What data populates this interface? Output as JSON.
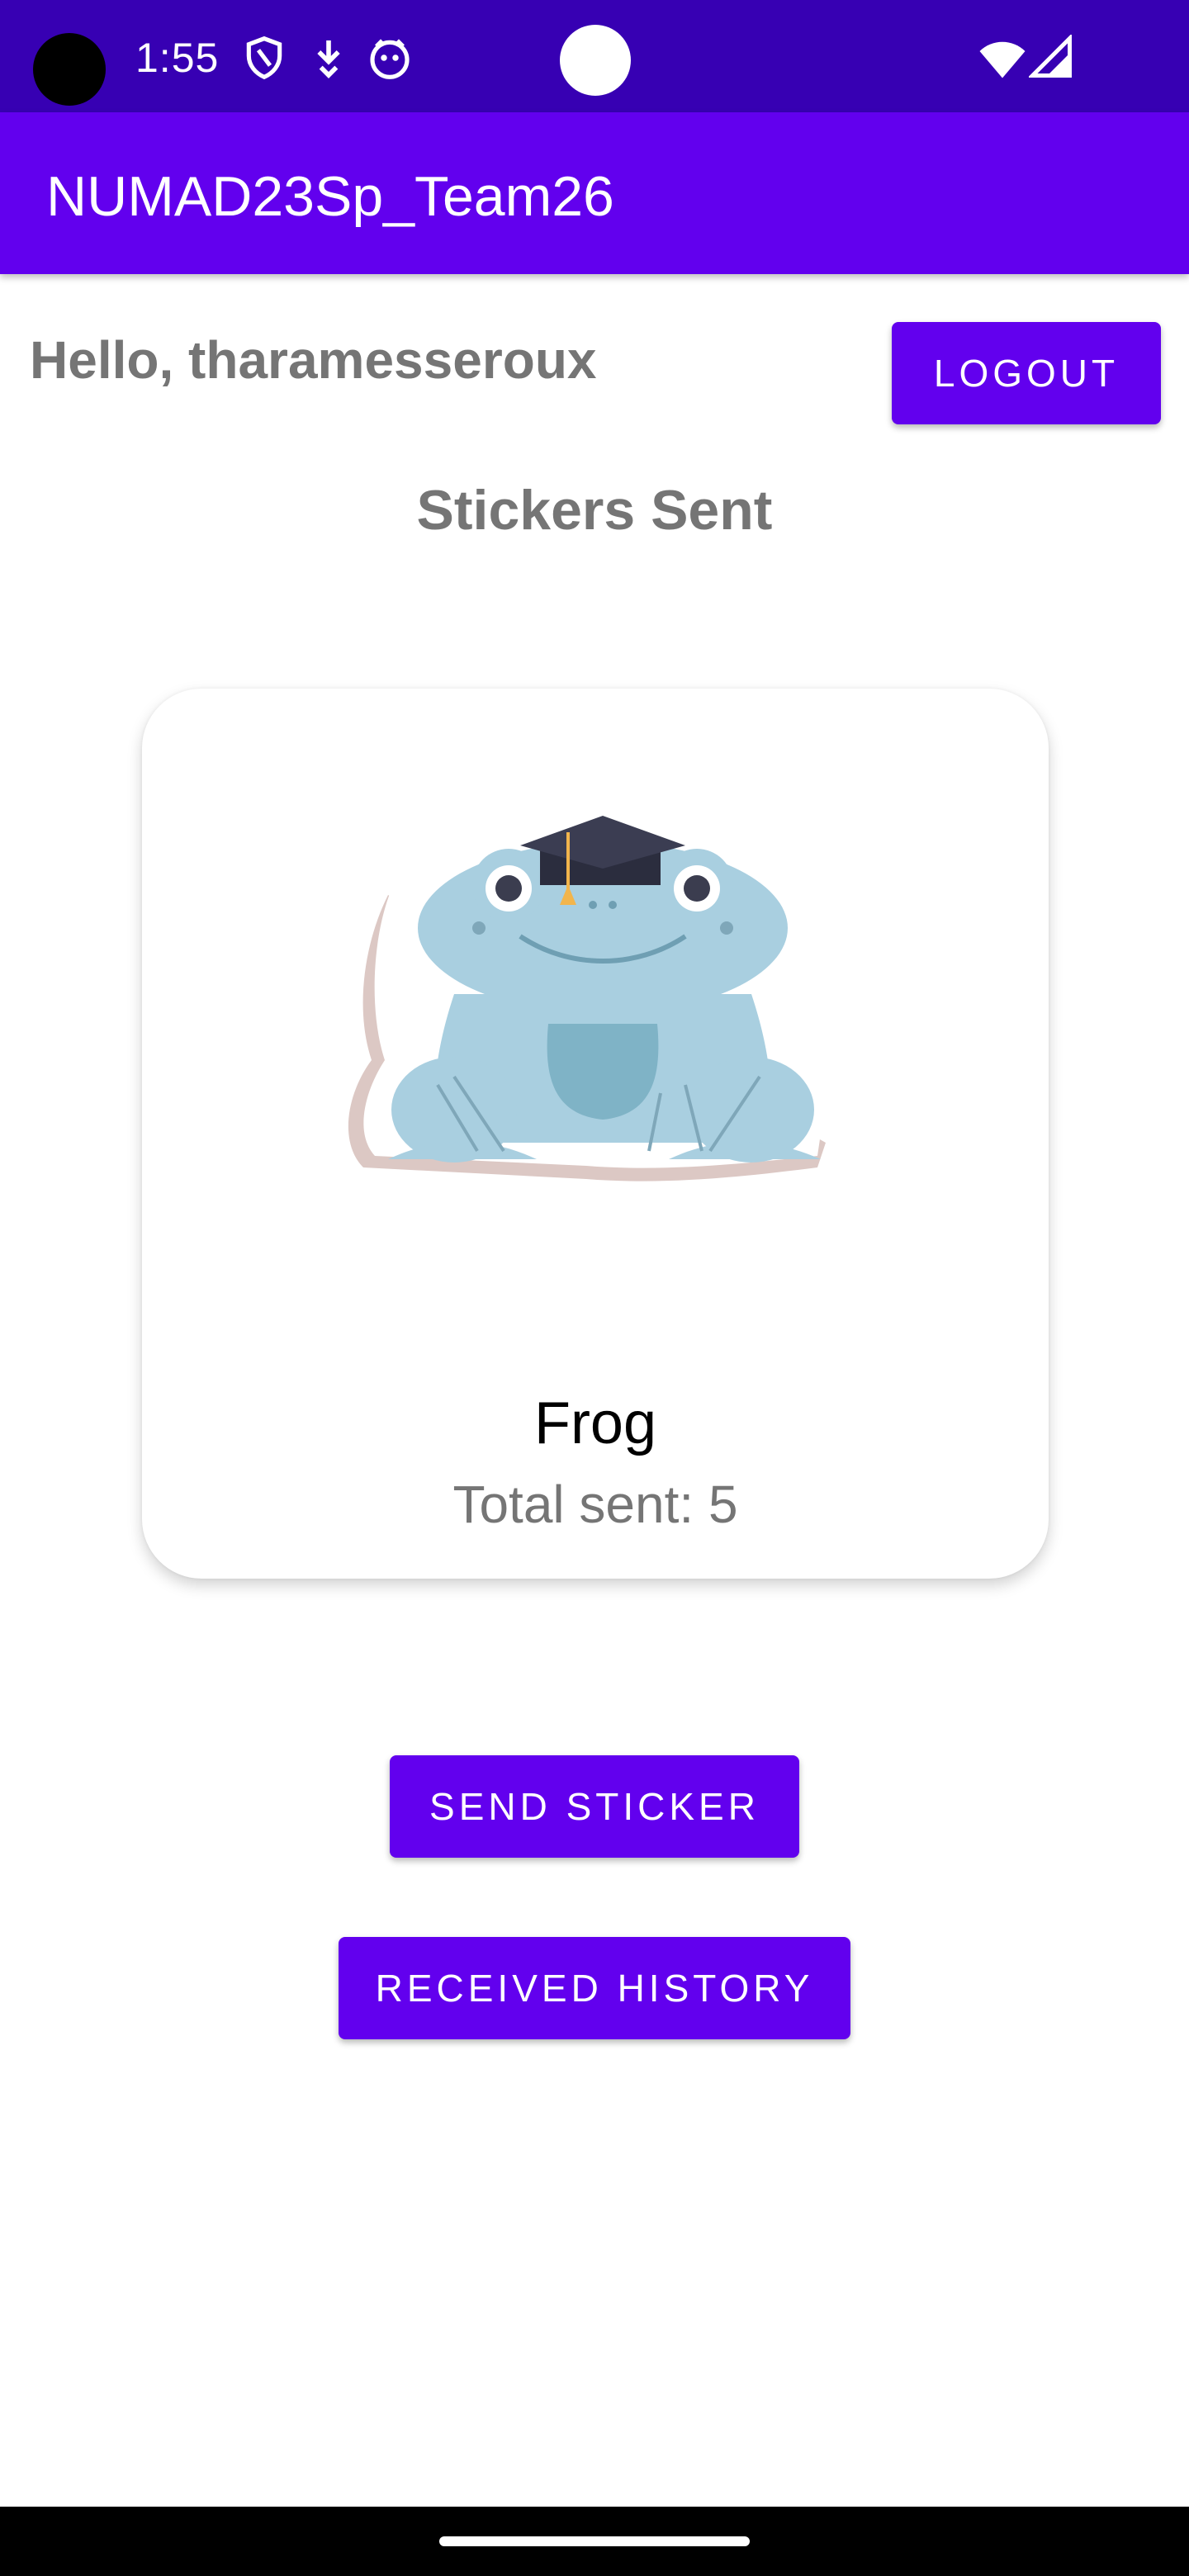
{
  "status_bar": {
    "time": "1:55",
    "icons": [
      "shield-icon",
      "download-icon",
      "face-icon",
      "wifi-icon",
      "cellular-signal-icon"
    ]
  },
  "app_bar": {
    "title": "NUMAD23Sp_Team26"
  },
  "header": {
    "greeting": "Hello, tharamesseroux",
    "logout_label": "LOGOUT"
  },
  "main": {
    "section_title": "Stickers Sent",
    "sticker": {
      "image": "frog-with-graduation-cap",
      "name": "Frog",
      "total_sent": "Total sent: 5"
    },
    "send_sticker_label": "SEND STICKER",
    "received_history_label": "RECEIVED HISTORY"
  },
  "colors": {
    "primary": "#6200ee",
    "primary_dark": "#3700b3",
    "secondary_text": "#757575"
  }
}
